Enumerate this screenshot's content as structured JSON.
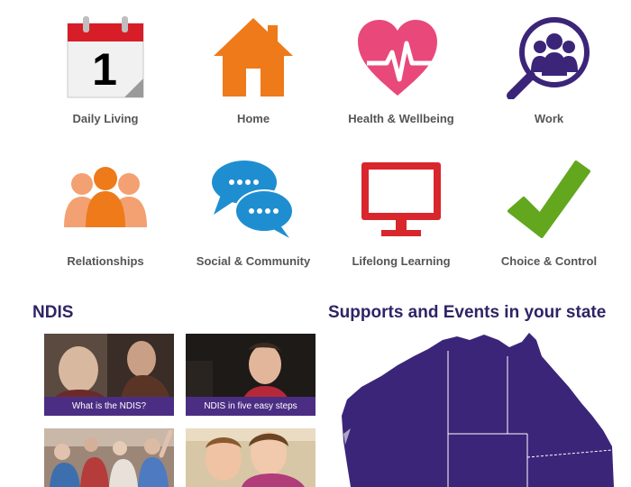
{
  "categories": [
    {
      "label": "Daily Living",
      "icon": "calendar-icon",
      "day": "1"
    },
    {
      "label": "Home",
      "icon": "house-icon"
    },
    {
      "label": "Health & Wellbeing",
      "icon": "heart-pulse-icon"
    },
    {
      "label": "Work",
      "icon": "people-magnifier-icon"
    },
    {
      "label": "Relationships",
      "icon": "people-group-icon"
    },
    {
      "label": "Social & Community",
      "icon": "chat-bubbles-icon"
    },
    {
      "label": "Lifelong Learning",
      "icon": "monitor-icon"
    },
    {
      "label": "Choice & Control",
      "icon": "checkmark-icon"
    }
  ],
  "ndis": {
    "title": "NDIS",
    "videos": [
      {
        "caption": "What is the NDIS?"
      },
      {
        "caption": "NDIS in five easy steps"
      },
      {
        "caption": ""
      },
      {
        "caption": ""
      }
    ]
  },
  "supports": {
    "title": "Supports and Events in your state",
    "map_icon": "australia-map-icon"
  },
  "colors": {
    "heading": "#2e2466",
    "orange": "#ee7a1a",
    "pink": "#e8497a",
    "purple": "#3b2579",
    "peach": "#f3a172",
    "blue": "#1f8ed0",
    "red": "#d8262c",
    "green": "#63a71f",
    "caption_bar": "#4b2e83"
  }
}
